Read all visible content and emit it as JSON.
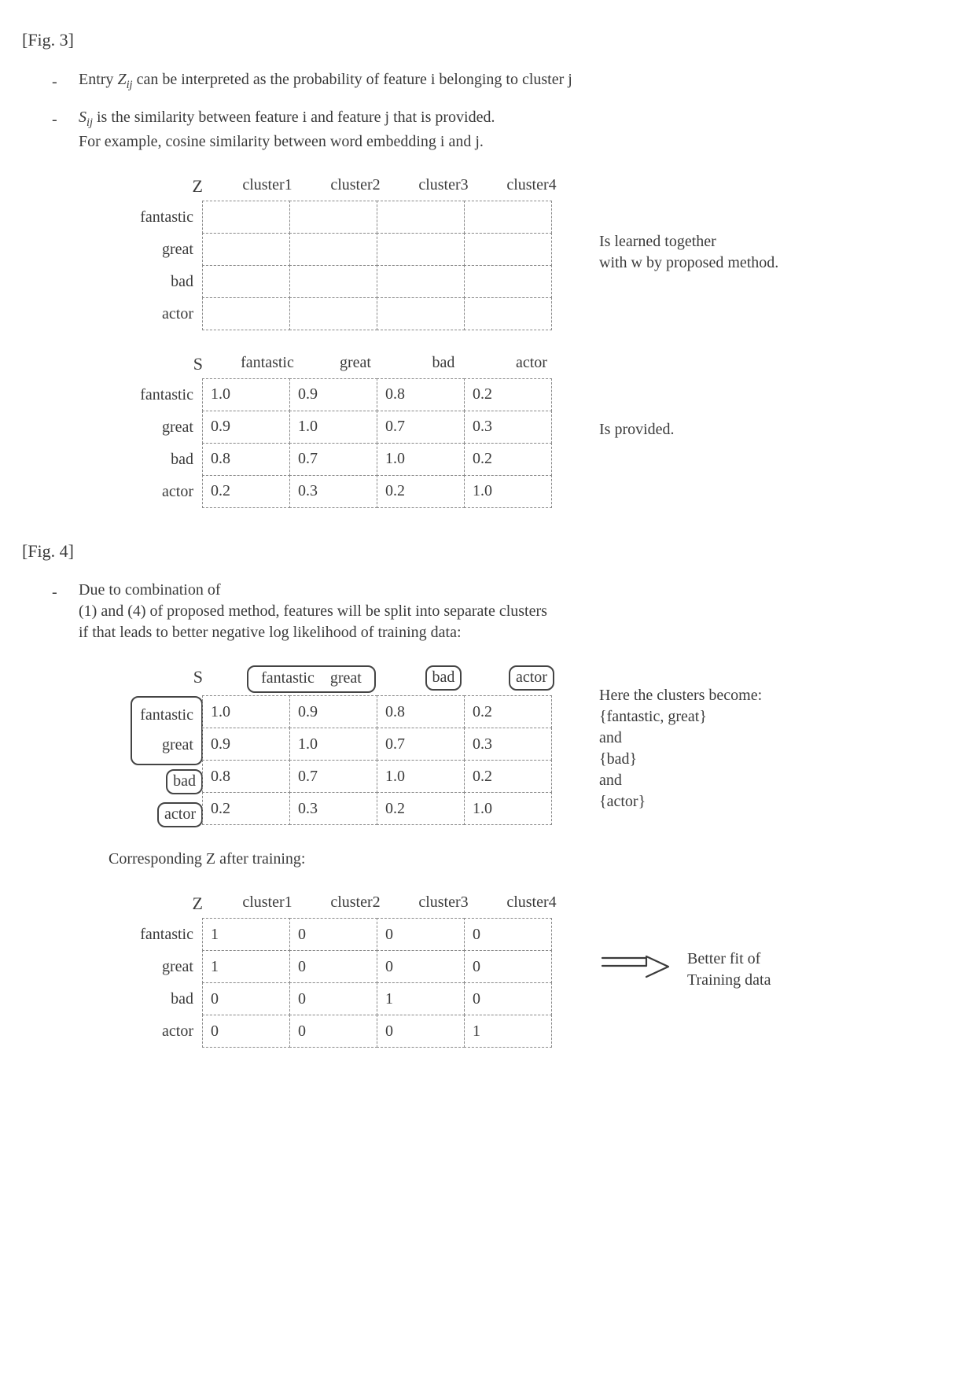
{
  "fig3": {
    "label": "[Fig. 3]",
    "b1_pre": "Entry ",
    "b1_var": "Z",
    "b1_sub": "ij",
    "b1_post": " can be interpreted as the probability of feature i belonging to cluster j",
    "b2_var": "S",
    "b2_sub": "ij",
    "b2_line1": " is the similarity between feature i and feature j that is provided.",
    "b2_line2": "For example, cosine similarity between word embedding i and j.",
    "z": {
      "corner": "Z",
      "cols": [
        "cluster1",
        "cluster2",
        "cluster3",
        "cluster4"
      ],
      "rows": [
        "fantastic",
        "great",
        "bad",
        "actor"
      ],
      "note1": "Is learned together",
      "note2": "with w by proposed method."
    },
    "s": {
      "corner": "S",
      "cols": [
        "fantastic",
        "great",
        "bad",
        "actor"
      ],
      "rows": [
        "fantastic",
        "great",
        "bad",
        "actor"
      ],
      "cells": [
        [
          "1.0",
          "0.9",
          "0.8",
          "0.2"
        ],
        [
          "0.9",
          "1.0",
          "0.7",
          "0.3"
        ],
        [
          "0.8",
          "0.7",
          "1.0",
          "0.2"
        ],
        [
          "0.2",
          "0.3",
          "0.2",
          "1.0"
        ]
      ],
      "note": "Is provided."
    }
  },
  "fig4": {
    "label": "[Fig. 4]",
    "bl1": "Due to combination of",
    "bl2": "(1) and (4) of proposed method, features will be split into separate clusters",
    "bl3": "if that leads to better negative log likelihood of training data:",
    "s": {
      "corner": "S",
      "cols": [
        "fantastic",
        "great",
        "bad",
        "actor"
      ],
      "rows": [
        "fantastic",
        "great",
        "bad",
        "actor"
      ],
      "cells": [
        [
          "1.0",
          "0.9",
          "0.8",
          "0.2"
        ],
        [
          "0.9",
          "1.0",
          "0.7",
          "0.3"
        ],
        [
          "0.8",
          "0.7",
          "1.0",
          "0.2"
        ],
        [
          "0.2",
          "0.3",
          "0.2",
          "1.0"
        ]
      ],
      "note_l1": "Here the clusters become:",
      "note_l2": "{fantastic, great}",
      "note_l3": "and",
      "note_l4": "{bad}",
      "note_l5": "and",
      "note_l6": "{actor}"
    },
    "corresp": "Corresponding Z after training:",
    "z": {
      "corner": "Z",
      "cols": [
        "cluster1",
        "cluster2",
        "cluster3",
        "cluster4"
      ],
      "rows": [
        "fantastic",
        "great",
        "bad",
        "actor"
      ],
      "cells": [
        [
          "1",
          "0",
          "0",
          "0"
        ],
        [
          "1",
          "0",
          "0",
          "0"
        ],
        [
          "0",
          "0",
          "1",
          "0"
        ],
        [
          "0",
          "0",
          "0",
          "1"
        ]
      ],
      "arrow_note1": "Better fit of",
      "arrow_note2": "Training data"
    }
  },
  "chart_data": [
    {
      "type": "table",
      "title": "Z matrix (Fig. 3) — feature→cluster probability, empty before training",
      "columns": [
        "cluster1",
        "cluster2",
        "cluster3",
        "cluster4"
      ],
      "rows": [
        "fantastic",
        "great",
        "bad",
        "actor"
      ],
      "values": [
        [
          null,
          null,
          null,
          null
        ],
        [
          null,
          null,
          null,
          null
        ],
        [
          null,
          null,
          null,
          null
        ],
        [
          null,
          null,
          null,
          null
        ]
      ]
    },
    {
      "type": "table",
      "title": "S similarity matrix (Fig. 3 / Fig. 4)",
      "columns": [
        "fantastic",
        "great",
        "bad",
        "actor"
      ],
      "rows": [
        "fantastic",
        "great",
        "bad",
        "actor"
      ],
      "values": [
        [
          1.0,
          0.9,
          0.8,
          0.2
        ],
        [
          0.9,
          1.0,
          0.7,
          0.3
        ],
        [
          0.8,
          0.7,
          1.0,
          0.2
        ],
        [
          0.2,
          0.3,
          0.2,
          1.0
        ]
      ]
    },
    {
      "type": "table",
      "title": "Z matrix after training (Fig. 4)",
      "columns": [
        "cluster1",
        "cluster2",
        "cluster3",
        "cluster4"
      ],
      "rows": [
        "fantastic",
        "great",
        "bad",
        "actor"
      ],
      "values": [
        [
          1,
          0,
          0,
          0
        ],
        [
          1,
          0,
          0,
          0
        ],
        [
          0,
          0,
          1,
          0
        ],
        [
          0,
          0,
          0,
          1
        ]
      ]
    }
  ]
}
